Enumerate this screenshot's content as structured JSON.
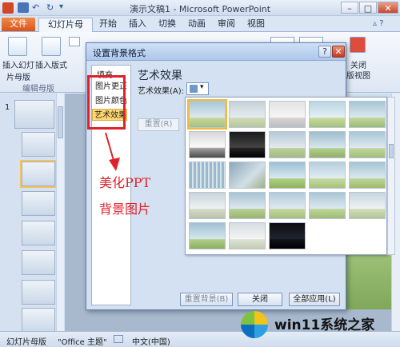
{
  "window": {
    "title": "演示文稿1 - Microsoft PowerPoint"
  },
  "ribbon": {
    "tabs": [
      "文件",
      "幻灯片母版",
      "开始",
      "插入",
      "切换",
      "动画",
      "审阅",
      "视图"
    ],
    "insert_slide_master": "插入幻灯\n片母版",
    "insert_layout": "插入版式",
    "group_edit_master": "编辑母版",
    "close_label": "关闭",
    "close_view_label": "版视图"
  },
  "thumbnails": {
    "first_number": "1"
  },
  "dialog": {
    "title": "设置背景格式",
    "help": "?",
    "nav": [
      "填充",
      "图片更正",
      "图片颜色",
      "艺术效果"
    ],
    "section_title": "艺术效果",
    "effect_label": "艺术效果(A):",
    "reset": "重置(R)",
    "reset_background": "重置背景(B)",
    "close": "关闭",
    "apply_all": "全部应用(L)"
  },
  "annotation": {
    "line1": "美化PPT",
    "line2": "背景图片",
    "color": "#e0212a"
  },
  "status": {
    "view": "幻灯片母版",
    "theme": "\"Office 主题\"",
    "language": "中文(中国)"
  },
  "watermark": {
    "text": "win11系统之家"
  }
}
